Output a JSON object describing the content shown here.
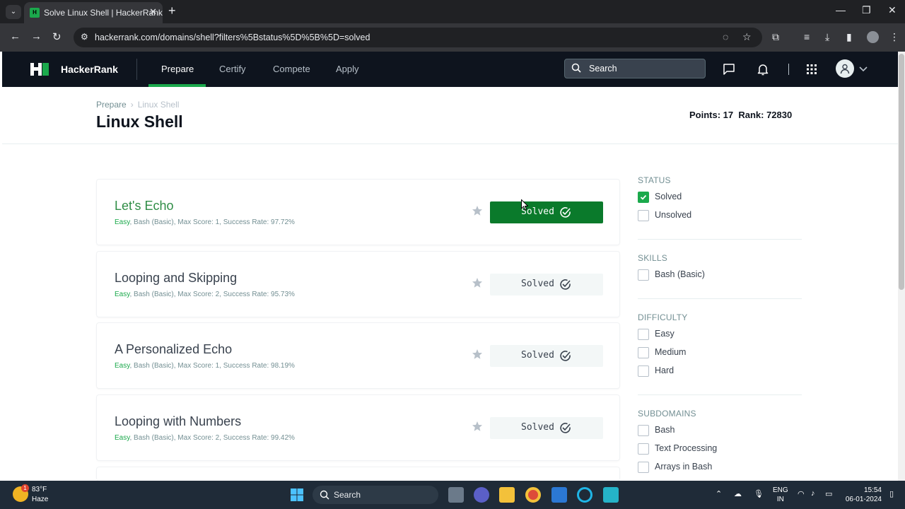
{
  "browser": {
    "tab_title": "Solve Linux Shell | HackerRank",
    "favicon_text": "H",
    "url": "hackerrank.com/domains/shell?filters%5Bstatus%5D%5B%5D=solved",
    "new_tab_glyph": "+",
    "close_glyph": "✕"
  },
  "nav": {
    "brand": "HackerRank",
    "links": [
      "Prepare",
      "Certify",
      "Compete",
      "Apply"
    ],
    "active": "Prepare",
    "search_placeholder": "Search"
  },
  "breadcrumb": {
    "root": "Prepare",
    "current": "Linux Shell",
    "separator": "›"
  },
  "page": {
    "title": "Linux Shell",
    "stats": "Points: 17  Rank: 72830"
  },
  "challenges": [
    {
      "title": "Let's Echo",
      "difficulty": "Easy",
      "meta": ", Bash (Basic), Max Score: 1, Success Rate: 97.72%",
      "status": "Solved",
      "highlighted": true
    },
    {
      "title": "Looping and Skipping",
      "difficulty": "Easy",
      "meta": ", Bash (Basic), Max Score: 2, Success Rate: 95.73%",
      "status": "Solved",
      "highlighted": false
    },
    {
      "title": "A Personalized Echo",
      "difficulty": "Easy",
      "meta": ", Bash (Basic), Max Score: 1, Success Rate: 98.19%",
      "status": "Solved",
      "highlighted": false
    },
    {
      "title": "Looping with Numbers",
      "difficulty": "Easy",
      "meta": ", Bash (Basic), Max Score: 2, Success Rate: 99.42%",
      "status": "Solved",
      "highlighted": false
    }
  ],
  "filters": {
    "status": {
      "heading": "STATUS",
      "options": [
        {
          "label": "Solved",
          "checked": true
        },
        {
          "label": "Unsolved",
          "checked": false
        }
      ]
    },
    "skills": {
      "heading": "SKILLS",
      "options": [
        {
          "label": "Bash (Basic)",
          "checked": false
        }
      ]
    },
    "difficulty": {
      "heading": "DIFFICULTY",
      "options": [
        {
          "label": "Easy",
          "checked": false
        },
        {
          "label": "Medium",
          "checked": false
        },
        {
          "label": "Hard",
          "checked": false
        }
      ]
    },
    "subdomains": {
      "heading": "SUBDOMAINS",
      "options": [
        {
          "label": "Bash",
          "checked": false
        },
        {
          "label": "Text Processing",
          "checked": false
        },
        {
          "label": "Arrays in Bash",
          "checked": false
        }
      ]
    }
  },
  "taskbar": {
    "weather_temp": "83°F",
    "weather_desc": "Haze",
    "weather_badge": "1",
    "search_label": "Search",
    "lang_line1": "ENG",
    "lang_line2": "IN",
    "time": "15:54",
    "date": "06-01-2024"
  },
  "colors": {
    "nav_bg": "#0e141e",
    "accent_green": "#1ba94c",
    "solved_primary": "#0a7a2b",
    "title_green": "#2f8d46"
  }
}
